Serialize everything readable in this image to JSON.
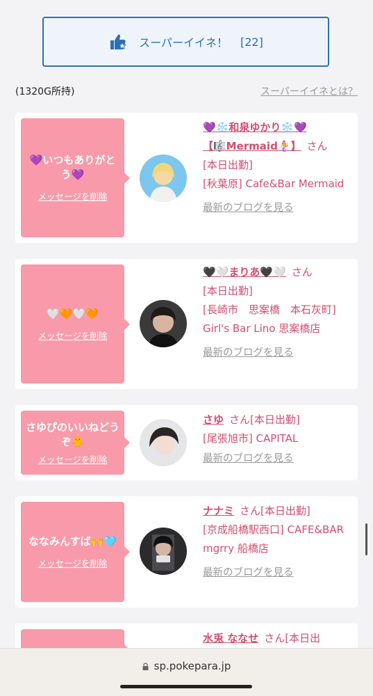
{
  "super_like": {
    "label": "スーパーイイネ！",
    "count": "[22]"
  },
  "owned_points": "(1320G所持)",
  "what_is_link": "スーパーイイネとは？",
  "delete_label": "メッセージを削除",
  "san": "さん",
  "blog_label": "最新のブログを見る",
  "cards": [
    {
      "message": "💜いつもありがとう💜",
      "name": "💜❄️和泉ゆかり❄️💜【🎼Mermaid🧜‍♀️】",
      "status": "[本日出勤]",
      "shop": "[秋葉原] Cafe&Bar Mermaid"
    },
    {
      "message": "🤍🧡🤍🧡",
      "name": "🖤🤍まりあ🖤🤍",
      "status": "[本日出勤]",
      "shop": "[長崎市　思案橋　本石灰町] Girl's Bar Lino 思案橋店"
    },
    {
      "message": "さゆぴのいいねどうぞ🐥",
      "name": "さゆ",
      "status": "[本日出勤]",
      "shop": "[尾張旭市] CAPITAL"
    },
    {
      "message": "ななみんすば🙌🩵",
      "name": "ナナミ",
      "status": "[本日出勤]",
      "shop": "[京成船橋駅西口] CAFE&BAR mgrry 船橋店"
    },
    {
      "name": "水兎 ななせ",
      "status": "[本日出"
    }
  ],
  "browser": {
    "url": "sp.pokepara.jp"
  }
}
